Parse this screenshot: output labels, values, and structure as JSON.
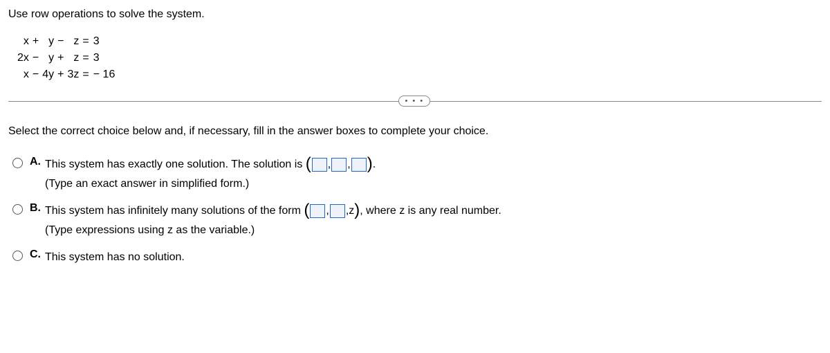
{
  "prompt": "Use row operations to solve the system.",
  "equations": {
    "r1": {
      "c1": "x",
      "op1": "+",
      "c2": "y",
      "op2": "−",
      "c3": "z",
      "eq": "=",
      "rhs": "3"
    },
    "r2": {
      "c1": "2x",
      "op1": "−",
      "c2": "y",
      "op2": "+",
      "c3": "z",
      "eq": "=",
      "rhs": "3"
    },
    "r3": {
      "c1": "x",
      "op1": "−",
      "c2": "4y",
      "op2": "+",
      "c3": "3z",
      "eq": "=",
      "rhs": "− 16"
    }
  },
  "dots": "• • •",
  "instruction": "Select the correct choice below and, if necessary, fill in the answer boxes to complete your choice.",
  "choices": {
    "a": {
      "label": "A.",
      "text_pre": "This system has exactly one solution. The solution is ",
      "text_post": ".",
      "hint": "(Type an exact answer in simplified form.)"
    },
    "b": {
      "label": "B.",
      "text_pre": "This system has infinitely many solutions of the form ",
      "z": "z",
      "text_post": ", where z is any real number.",
      "hint": "(Type expressions using z as the variable.)"
    },
    "c": {
      "label": "C.",
      "text": "This system has no solution."
    }
  }
}
